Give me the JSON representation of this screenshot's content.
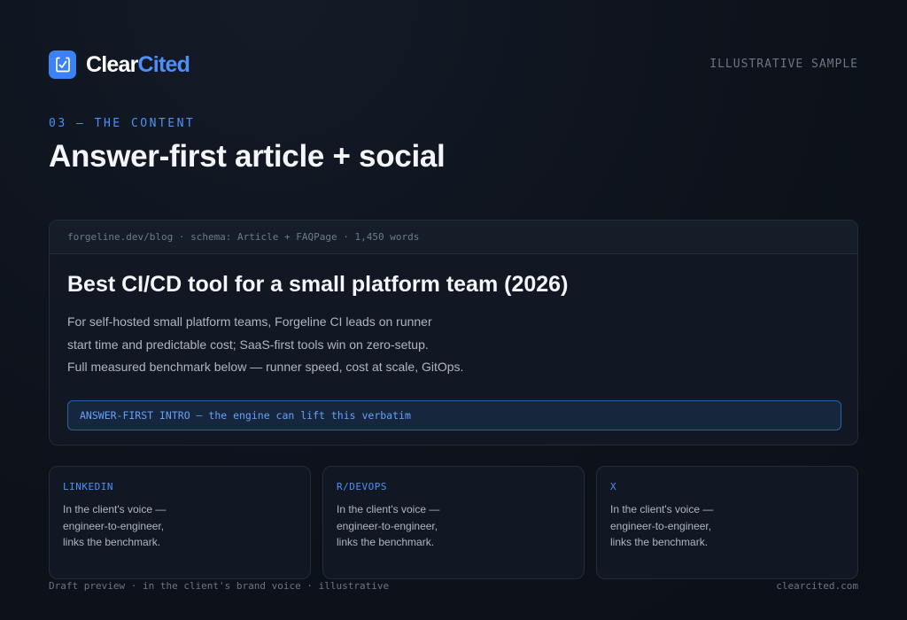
{
  "brand": {
    "name_part1": "Clear",
    "name_part2": "Cited"
  },
  "header": {
    "tag": "ILLUSTRATIVE SAMPLE"
  },
  "section": {
    "kicker": "03 — THE CONTENT",
    "title": "Answer-first article + social"
  },
  "article": {
    "meta": "forgeline.dev/blog · schema: Article + FAQPage · 1,450 words",
    "title": "Best CI/CD tool for a small platform team (2026)",
    "body_lines": [
      "For self-hosted small platform teams, Forgeline CI leads on runner",
      "start time and predictable cost; SaaS-first tools win on zero-setup.",
      "Full measured benchmark below — runner speed, cost at scale, GitOps."
    ],
    "callout": "ANSWER-FIRST INTRO — the engine can lift this verbatim"
  },
  "social_posts": [
    {
      "channel": "LINKEDIN",
      "lines": [
        "In the client's voice —",
        "engineer-to-engineer,",
        "links the benchmark."
      ]
    },
    {
      "channel": "R/DEVOPS",
      "lines": [
        "In the client's voice —",
        "engineer-to-engineer,",
        "links the benchmark."
      ]
    },
    {
      "channel": "X",
      "lines": [
        "In the client's voice —",
        "engineer-to-engineer,",
        "links the benchmark."
      ]
    }
  ],
  "footer": {
    "note": "Draft preview · in the client's brand voice · illustrative",
    "domain": "clearcited.com"
  },
  "colors": {
    "accent": "#3b82f6",
    "accent_text": "#4f8ff7",
    "background": "#0d121b",
    "card": "#111824"
  },
  "icons": {
    "logo": "checkbox-document-icon"
  }
}
